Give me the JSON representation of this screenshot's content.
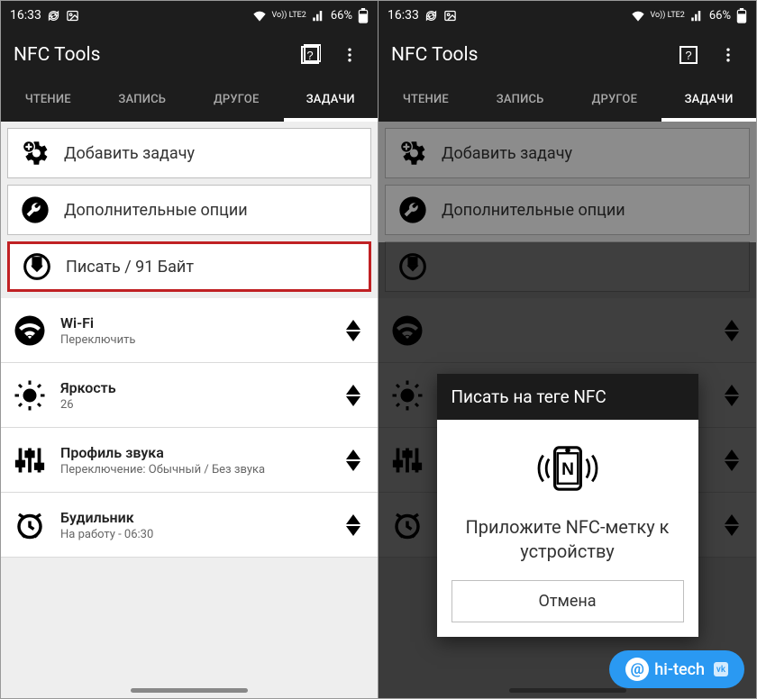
{
  "status": {
    "time": "16:33",
    "battery": "66%",
    "network_label": "Vo)) LTE2"
  },
  "app": {
    "title": "NFC Tools"
  },
  "tabs": [
    {
      "label": "ЧТЕНИЕ",
      "active": false
    },
    {
      "label": "ЗАПИСЬ",
      "active": false
    },
    {
      "label": "ДРУГОЕ",
      "active": false
    },
    {
      "label": "ЗАДАЧИ",
      "active": true
    }
  ],
  "actions": {
    "add_task": "Добавить задачу",
    "more_options": "Дополнительные опции",
    "write": "Писать / 91 Байт"
  },
  "tasks": [
    {
      "icon": "wifi-icon",
      "label": "Wi-Fi",
      "sub": "Переключить"
    },
    {
      "icon": "brightness-icon",
      "label": "Яркость",
      "sub": "26"
    },
    {
      "icon": "equalizer-icon",
      "label": "Профиль звука",
      "sub": "Переключение: Обычный / Без звука"
    },
    {
      "icon": "alarm-icon",
      "label": "Будильник",
      "sub": "На работу - 06:30"
    }
  ],
  "dialog": {
    "title": "Писать на теге NFC",
    "message": "Приложите NFC-метку к устройству",
    "cancel": "Отмена"
  },
  "watermark": {
    "text": "hi-tech"
  }
}
